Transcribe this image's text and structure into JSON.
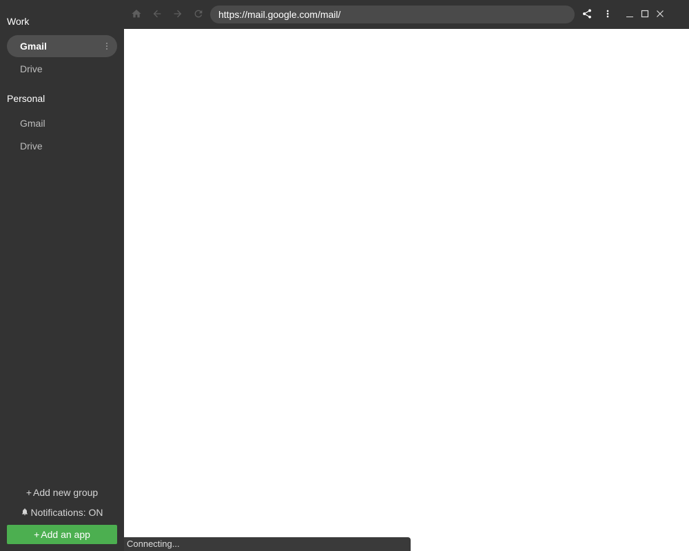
{
  "sidebar": {
    "groups": [
      {
        "title": "Work",
        "apps": [
          {
            "label": "Gmail",
            "active": true
          },
          {
            "label": "Drive",
            "active": false
          }
        ]
      },
      {
        "title": "Personal",
        "apps": [
          {
            "label": "Gmail",
            "active": false
          },
          {
            "label": "Drive",
            "active": false
          }
        ]
      }
    ],
    "add_group_label": "Add new group",
    "notifications_label": "Notifications: ON",
    "add_app_label": "Add an app"
  },
  "toolbar": {
    "url": "https://mail.google.com/mail/",
    "icons": [
      "home-icon",
      "back-icon",
      "forward-icon",
      "reload-icon",
      "share-icon",
      "more-vert-icon",
      "minimize-icon",
      "maximize-icon",
      "close-icon"
    ]
  },
  "status": {
    "text": "Connecting..."
  },
  "colors": {
    "sidebar_bg": "#333333",
    "active_item_bg": "#4f4f4f",
    "accent_green": "#4caf50",
    "url_bar_bg": "#4a4a4a"
  }
}
